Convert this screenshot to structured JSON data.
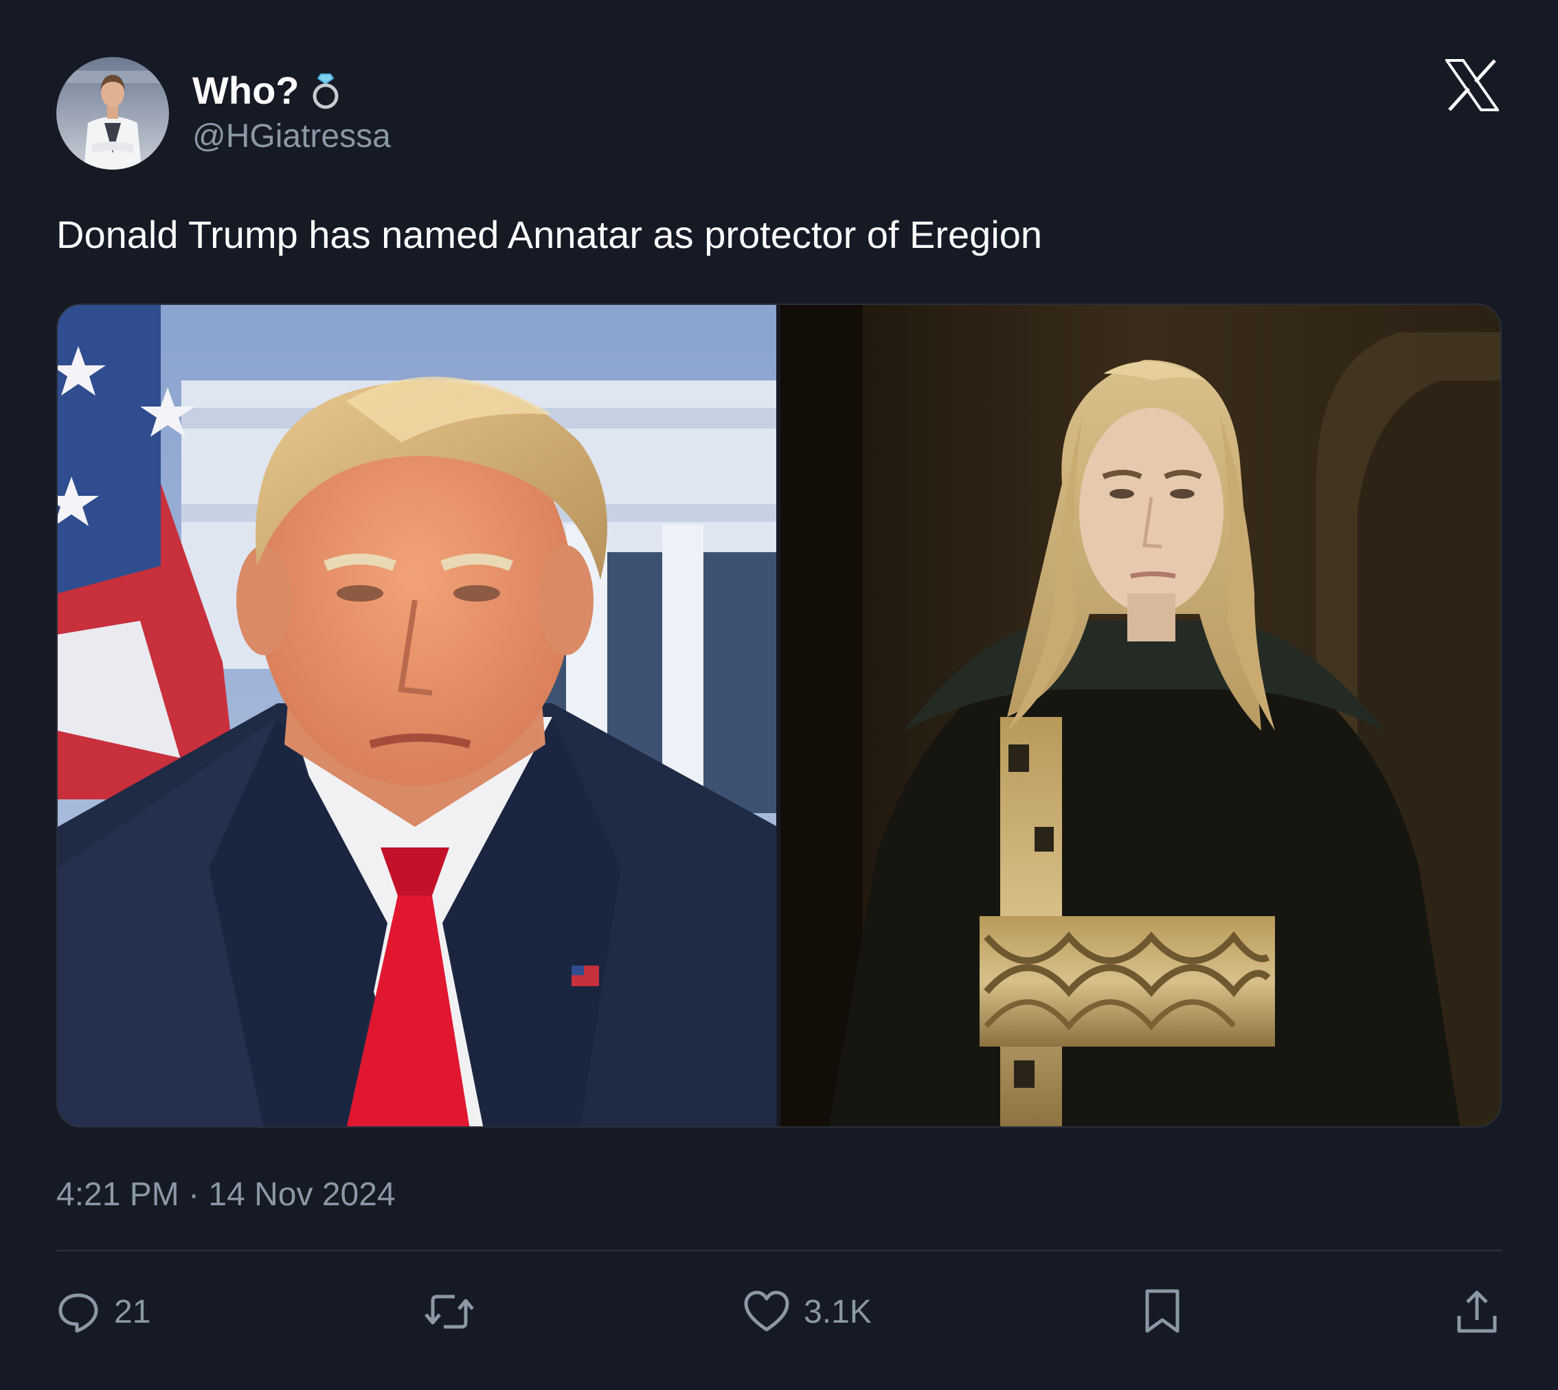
{
  "author": {
    "display_name": "Who?",
    "handle": "@HGiatressa",
    "badge_icon": "ring-icon",
    "avatar_icon": "profile-avatar"
  },
  "brand": {
    "logo_icon": "x-logo-icon"
  },
  "tweet": {
    "text": "Donald Trump has named Annatar as protector of Eregion",
    "timestamp": "4:21 PM · 14 Nov 2024"
  },
  "media": {
    "left_image": "photo-man-suit-red-tie-flag-background",
    "right_image": "photo-long-blond-hair-dark-robe-gold-belt"
  },
  "actions": {
    "reply": {
      "icon": "reply-icon",
      "count": "21"
    },
    "repost": {
      "icon": "repost-icon",
      "count": ""
    },
    "like": {
      "icon": "heart-icon",
      "count": "3.1K"
    },
    "bookmark": {
      "icon": "bookmark-icon"
    },
    "share": {
      "icon": "share-icon"
    }
  },
  "colors": {
    "background": "#161a25",
    "text_primary": "#ffffff",
    "text_secondary": "#8b98a5",
    "divider": "#2f3540"
  }
}
